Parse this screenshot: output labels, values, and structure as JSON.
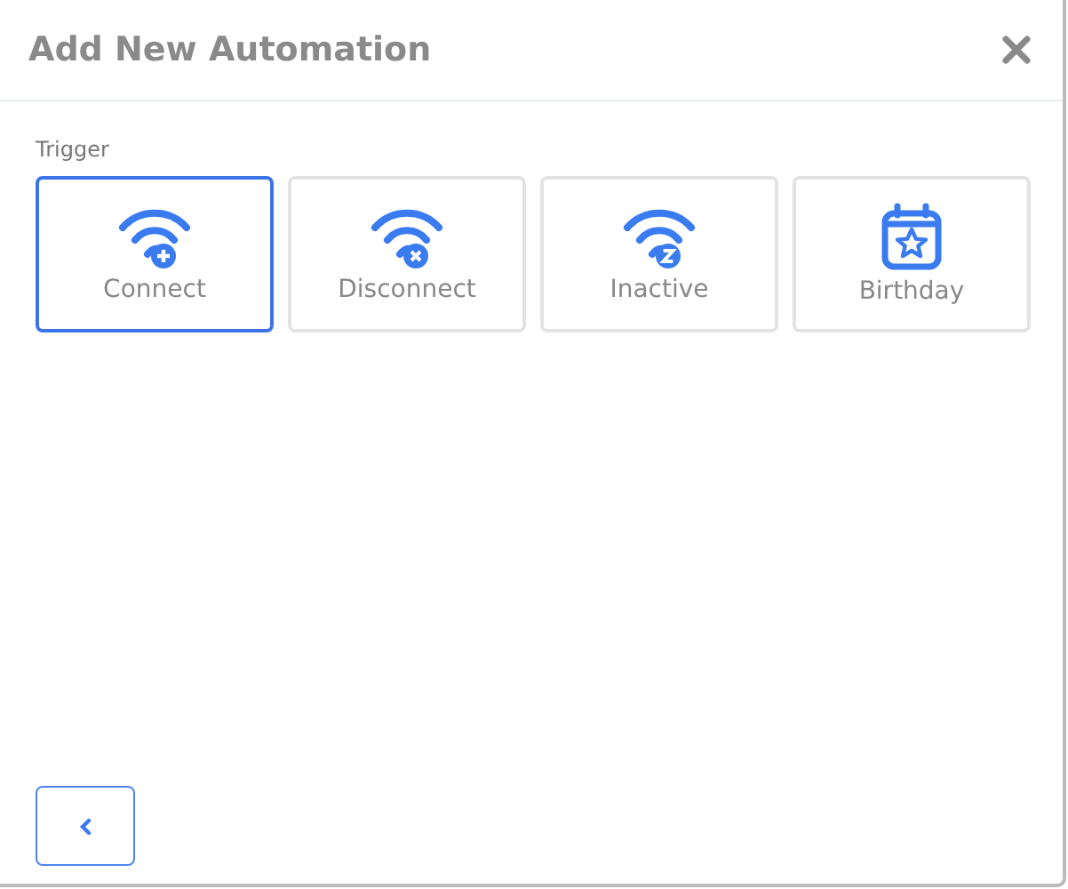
{
  "dialog": {
    "title": "Add New Automation"
  },
  "trigger": {
    "label": "Trigger",
    "options": [
      {
        "label": "Connect",
        "kind": "wifi-plus",
        "selected": true
      },
      {
        "label": "Disconnect",
        "kind": "wifi-x",
        "selected": false
      },
      {
        "label": "Inactive",
        "kind": "wifi-sleep",
        "selected": false
      },
      {
        "label": "Birthday",
        "kind": "calendar",
        "selected": false
      }
    ]
  }
}
